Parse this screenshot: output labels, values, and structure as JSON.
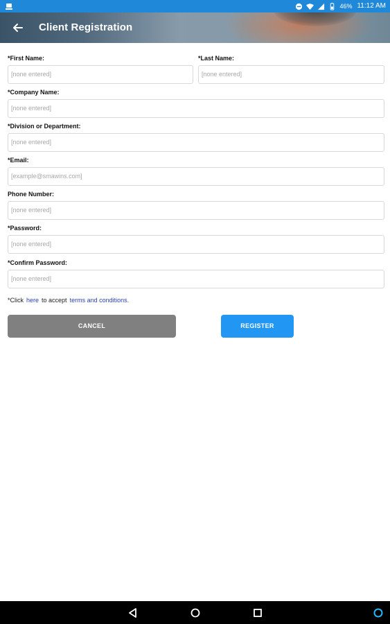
{
  "status_bar": {
    "left_icon": "notification-icon",
    "icons": [
      "minus-circle-icon",
      "wifi-icon",
      "signal-icon",
      "battery-icon"
    ],
    "battery": "46%",
    "time": "11:12 AM"
  },
  "app_bar": {
    "back_icon": "arrow-left-icon",
    "title": "Client Registration"
  },
  "form": {
    "first_name": {
      "label": "*First Name:",
      "value": "[none entered]"
    },
    "last_name": {
      "label": "*Last Name:",
      "value": "[none entered]"
    },
    "company_name": {
      "label": "*Company Name:",
      "value": "[none entered]"
    },
    "division": {
      "label": "*Division or Department:",
      "value": "[none entered]"
    },
    "email": {
      "label": "*Email:",
      "value": "[example@smawins.com]"
    },
    "phone": {
      "label": "Phone Number:",
      "value": "[none entered]"
    },
    "password": {
      "label": "*Password:",
      "value": "[none entered]"
    },
    "confirm_password": {
      "label": "*Confirm Password:",
      "value": "[none entered]"
    }
  },
  "terms": {
    "prefix": "*Click",
    "here_link": "here",
    "middle": "to accept",
    "terms_link": "terms and conditions."
  },
  "buttons": {
    "cancel": "CANCEL",
    "register": "REGISTER"
  },
  "nav_bar": {
    "icons": [
      "back-triangle-icon",
      "home-circle-icon",
      "recents-square-icon",
      "assistant-icon"
    ]
  },
  "colors": {
    "status_bar": "#1f88d9",
    "register_button": "#2196f3",
    "cancel_button": "#808080",
    "link": "#2a3fb5"
  }
}
